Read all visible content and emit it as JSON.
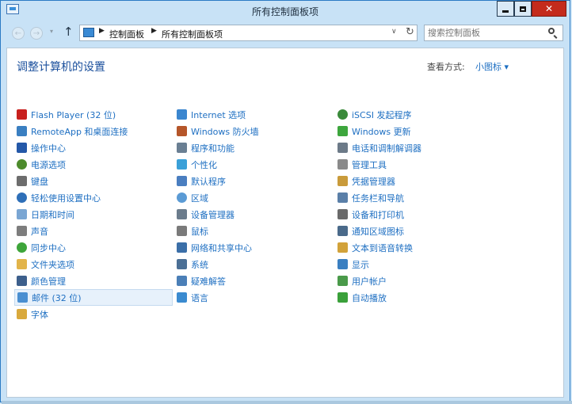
{
  "window": {
    "title": "所有控制面板项",
    "min_label": "最小化",
    "close_glyph": "✕"
  },
  "nav": {
    "back_glyph": "←",
    "forward_glyph": "→",
    "recent_glyph": "▾",
    "up_glyph": "↑",
    "breadcrumb": [
      "控制面板",
      "所有控制面板项"
    ],
    "dropdown_glyph": "∨",
    "refresh_glyph": "↻"
  },
  "search": {
    "placeholder": "搜索控制面板"
  },
  "content": {
    "heading": "调整计算机的设置",
    "view_by_label": "查看方式:",
    "view_by_value": "小图标 ▾"
  },
  "columns": [
    [
      {
        "label": "Flash Player (32 位)",
        "icon": "flash-icon",
        "color": "#c8201e"
      },
      {
        "label": "RemoteApp 和桌面连接",
        "icon": "remoteapp-icon",
        "color": "#3a7fc1"
      },
      {
        "label": "操作中心",
        "icon": "flag-icon",
        "color": "#2458a8"
      },
      {
        "label": "电源选项",
        "icon": "power-icon",
        "color": "#4d8b2c"
      },
      {
        "label": "键盘",
        "icon": "keyboard-icon",
        "color": "#6d6d6d"
      },
      {
        "label": "轻松使用设置中心",
        "icon": "ease-of-access-icon",
        "color": "#2e6fb8"
      },
      {
        "label": "日期和时间",
        "icon": "calendar-icon",
        "color": "#7aa6d3"
      },
      {
        "label": "声音",
        "icon": "speaker-icon",
        "color": "#7d7d7d"
      },
      {
        "label": "同步中心",
        "icon": "sync-icon",
        "color": "#3ea53a"
      },
      {
        "label": "文件夹选项",
        "icon": "folder-options-icon",
        "color": "#e2b44a"
      },
      {
        "label": "颜色管理",
        "icon": "color-management-icon",
        "color": "#3d5f8c"
      },
      {
        "label": "邮件 (32 位)",
        "icon": "mail-icon",
        "color": "#4a8fd1",
        "selected": true
      },
      {
        "label": "字体",
        "icon": "fonts-icon",
        "color": "#d9a93c"
      }
    ],
    [
      {
        "label": "Internet 选项",
        "icon": "internet-options-icon",
        "color": "#3b86cf"
      },
      {
        "label": "Windows 防火墙",
        "icon": "firewall-icon",
        "color": "#b5562a"
      },
      {
        "label": "程序和功能",
        "icon": "programs-icon",
        "color": "#6a7f93"
      },
      {
        "label": "个性化",
        "icon": "personalization-icon",
        "color": "#3aa0d8"
      },
      {
        "label": "默认程序",
        "icon": "default-programs-icon",
        "color": "#4a7ec0"
      },
      {
        "label": "区域",
        "icon": "region-icon",
        "color": "#5b9bd5"
      },
      {
        "label": "设备管理器",
        "icon": "device-manager-icon",
        "color": "#6b7c8c"
      },
      {
        "label": "鼠标",
        "icon": "mouse-icon",
        "color": "#7a7a7a"
      },
      {
        "label": "网络和共享中心",
        "icon": "network-icon",
        "color": "#3b6fa8"
      },
      {
        "label": "系统",
        "icon": "system-icon",
        "color": "#4b6f95"
      },
      {
        "label": "疑难解答",
        "icon": "troubleshooting-icon",
        "color": "#4b7fb7"
      },
      {
        "label": "语言",
        "icon": "language-icon",
        "color": "#3b8bd0"
      }
    ],
    [
      {
        "label": "iSCSI 发起程序",
        "icon": "iscsi-icon",
        "color": "#3a8a3a"
      },
      {
        "label": "Windows 更新",
        "icon": "windows-update-icon",
        "color": "#3da63d"
      },
      {
        "label": "电话和调制解调器",
        "icon": "phone-modem-icon",
        "color": "#6c7a88"
      },
      {
        "label": "管理工具",
        "icon": "admin-tools-icon",
        "color": "#8a8a8a"
      },
      {
        "label": "凭据管理器",
        "icon": "credential-manager-icon",
        "color": "#c99b3b"
      },
      {
        "label": "任务栏和导航",
        "icon": "taskbar-icon",
        "color": "#5a7fa8"
      },
      {
        "label": "设备和打印机",
        "icon": "printer-icon",
        "color": "#6a6a6a"
      },
      {
        "label": "通知区域图标",
        "icon": "notification-area-icon",
        "color": "#4a6a8a"
      },
      {
        "label": "文本到语音转换",
        "icon": "speech-icon",
        "color": "#d2a23a"
      },
      {
        "label": "显示",
        "icon": "display-icon",
        "color": "#3a7fc1"
      },
      {
        "label": "用户帐户",
        "icon": "user-accounts-icon",
        "color": "#4a9a4a"
      },
      {
        "label": "自动播放",
        "icon": "autoplay-icon",
        "color": "#3aa03a"
      }
    ]
  ]
}
